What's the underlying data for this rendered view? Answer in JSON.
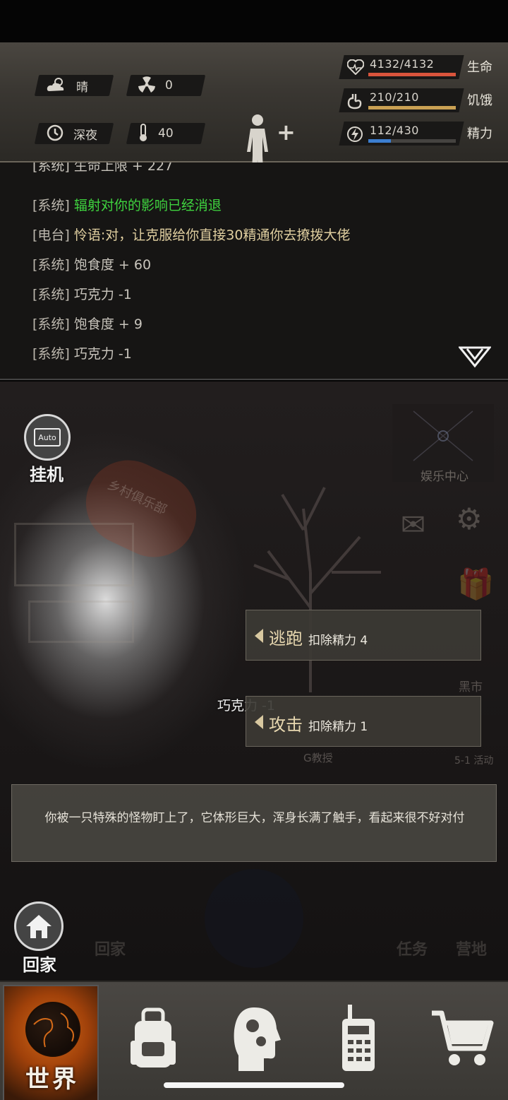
{
  "status": {
    "weather": "晴",
    "radiation": "0",
    "time_of_day": "深夜",
    "temperature": "40"
  },
  "vitals": [
    {
      "value": "4132/4132",
      "label": "生命",
      "icon": "heart-icon",
      "color": "#d9543c",
      "fraction": 1.0
    },
    {
      "value": "210/210",
      "label": "饥饿",
      "icon": "stomach-icon",
      "color": "#c9a053",
      "fraction": 1.0
    },
    {
      "value": "112/430",
      "label": "精力",
      "icon": "energy-icon",
      "color": "#3c7ed0",
      "fraction": 0.26
    }
  ],
  "log": {
    "partial_line": "[系统] 生命上限 + 227",
    "lines": [
      {
        "tag": "[系统]",
        "text": "辐射对你的影响已经消退",
        "style": "green"
      },
      {
        "tag": "[电台]",
        "speaker": "怜语",
        "text": ":对，让克服给你直接30精通你去撩拨大佬",
        "style": "radio"
      },
      {
        "tag": "[系统]",
        "text": "饱食度 + 60",
        "style": "normal"
      },
      {
        "tag": "[系统]",
        "text": "巧克力 -1",
        "style": "normal"
      },
      {
        "tag": "[系统]",
        "text": "饱食度 + 9",
        "style": "normal"
      },
      {
        "tag": "[系统]",
        "text": "巧克力 -1",
        "style": "normal"
      }
    ]
  },
  "scene": {
    "auto_label": "挂机",
    "auto_screen": "Auto",
    "sign_text": "乡村俱乐部",
    "entertainment": "娱乐中心",
    "black_market": "黑市",
    "g_sign": "G教授",
    "event_label": "5-1 活动",
    "floating_text": "巧克力 -1",
    "actions": [
      {
        "name": "逃跑",
        "cost": "扣除精力 4"
      },
      {
        "name": "攻击",
        "cost": "扣除精力 1"
      }
    ],
    "message": "你被一只特殊的怪物盯上了，它体形巨大，浑身长满了触手，看起来很不好对付",
    "home_label": "回家",
    "ghost_home": "回家",
    "ghost_task": "任务",
    "ghost_camp": "营地"
  },
  "nav": {
    "world": "世界",
    "accent": "#d46a18"
  }
}
